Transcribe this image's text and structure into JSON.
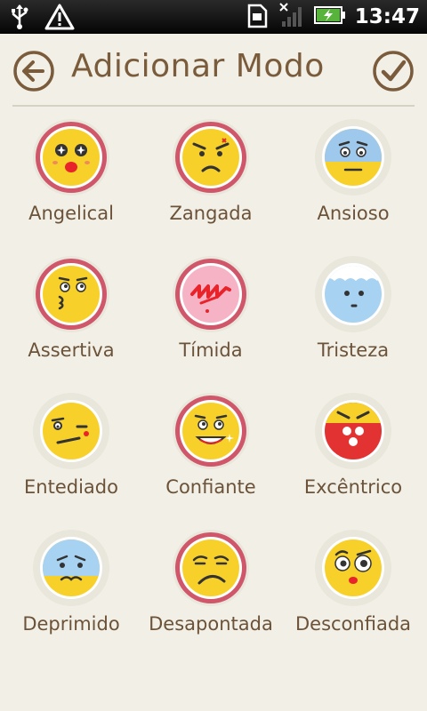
{
  "status_bar": {
    "time": "13:47"
  },
  "header": {
    "title": "Adicionar Modo"
  },
  "moods": [
    {
      "label": "Angelical",
      "selected": true,
      "face": "#f7d12a"
    },
    {
      "label": "Zangada",
      "selected": true,
      "face": "#f7d12a"
    },
    {
      "label": "Ansioso",
      "selected": false,
      "face": "#9fc9ec"
    },
    {
      "label": "Assertiva",
      "selected": true,
      "face": "#f7d12a"
    },
    {
      "label": "Tímida",
      "selected": true,
      "face": "#f7b3c6"
    },
    {
      "label": "Tristeza",
      "selected": false,
      "face": "#a8d2f2"
    },
    {
      "label": "Entediado",
      "selected": false,
      "face": "#f7d12a"
    },
    {
      "label": "Confiante",
      "selected": true,
      "face": "#f7d12a"
    },
    {
      "label": "Excêntrico",
      "selected": false,
      "face": "#e23232"
    },
    {
      "label": "Deprimido",
      "selected": false,
      "face": "#a8d2f2"
    },
    {
      "label": "Desapontada",
      "selected": true,
      "face": "#f7d12a"
    },
    {
      "label": "Desconfiada",
      "selected": false,
      "face": "#f7d12a"
    }
  ]
}
